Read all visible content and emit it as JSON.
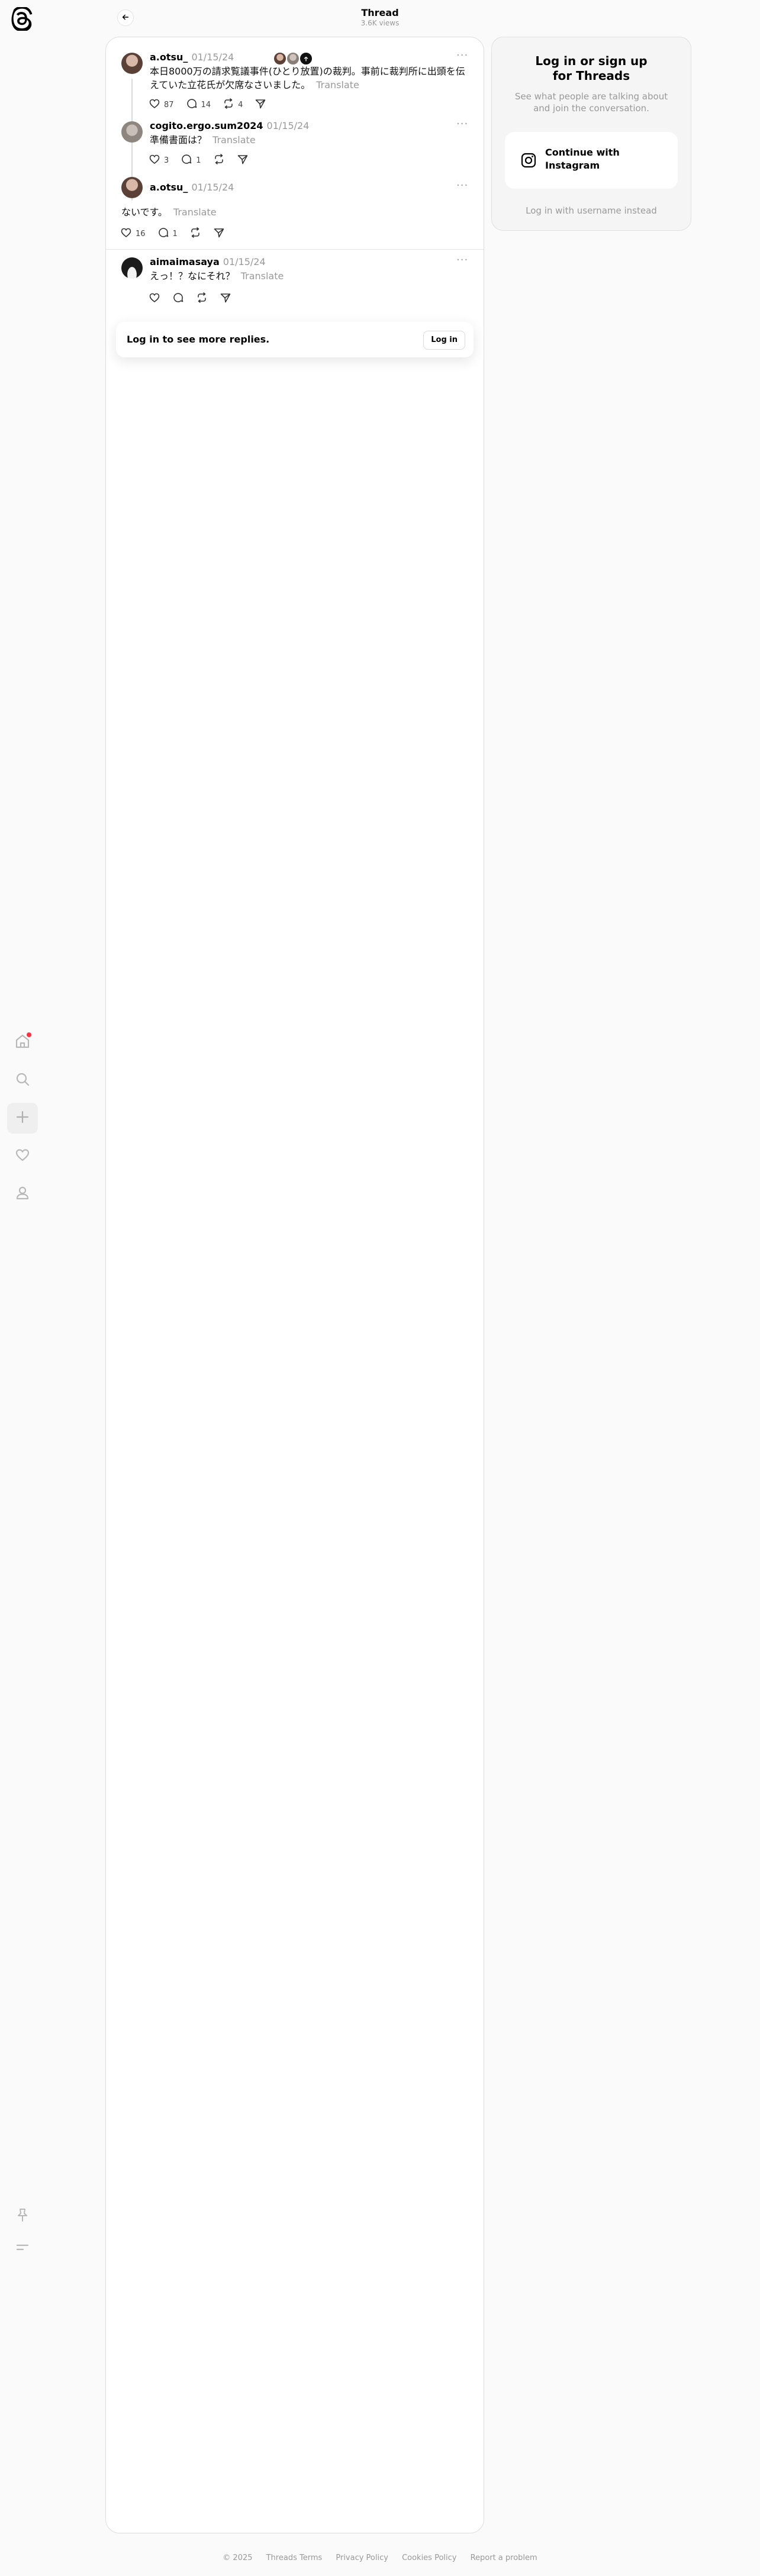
{
  "header": {
    "title": "Thread",
    "views": "3.6K views"
  },
  "sidebar": {
    "logo": "threads-logo",
    "items": [
      {
        "name": "home",
        "icon": "home-icon",
        "has_badge": true
      },
      {
        "name": "search",
        "icon": "search-icon"
      },
      {
        "name": "create",
        "icon": "plus-icon"
      },
      {
        "name": "activity",
        "icon": "heart-icon"
      },
      {
        "name": "profile",
        "icon": "profile-icon"
      }
    ],
    "bottom": [
      {
        "name": "pin",
        "icon": "pin-icon"
      },
      {
        "name": "menu",
        "icon": "menu-icon"
      }
    ]
  },
  "posts": [
    {
      "username": "a.otsu_",
      "time": "01/15/24",
      "text": "本日8000万の請求覧議事件(ひとり放置)の裁判。事前に裁判所に出頭を伝えていた立花氏が欠席なさいました。",
      "translate": "Translate",
      "likes": "87",
      "replies": "14",
      "reposts": "4"
    },
    {
      "username": "cogito.ergo.sum2024",
      "time": "01/15/24",
      "text": "準備書面は？",
      "translate": "Translate",
      "likes": "3",
      "replies": "1",
      "reposts": ""
    },
    {
      "username": "a.otsu_",
      "time": "01/15/24",
      "text": "ないです。",
      "translate": "Translate",
      "likes": "16",
      "replies": "1",
      "reposts": ""
    },
    {
      "username": "aimaimasaya",
      "time": "01/15/24",
      "text": "えっ！？なにそれ？",
      "translate": "Translate",
      "likes": "",
      "replies": "",
      "reposts": ""
    }
  ],
  "more_label": "···",
  "login_prompt": {
    "text": "Log in to see more replies.",
    "button": "Log in"
  },
  "login_card": {
    "title": "Log in or sign up for Threads",
    "subtitle": "See what people are talking about and join the conversation.",
    "instagram_button": "Continue with Instagram",
    "username_link": "Log in with username instead"
  },
  "footer": {
    "copyright": "© 2025",
    "links": [
      "Threads Terms",
      "Privacy Policy",
      "Cookies Policy",
      "Report a problem"
    ]
  },
  "colors": {
    "accent": "#ff3040",
    "secondary_text": "#999999",
    "thread_line": "#d9d9d9"
  }
}
